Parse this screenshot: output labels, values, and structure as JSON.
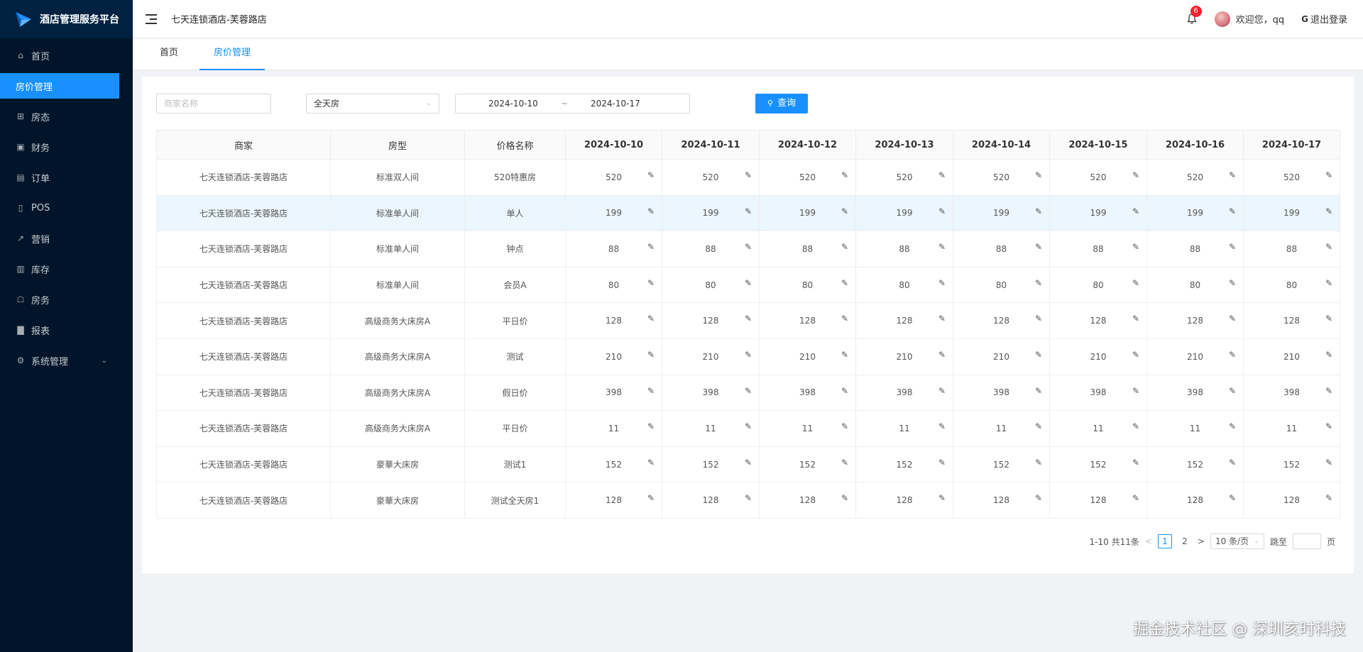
{
  "app": {
    "title": "酒店管理服务平台"
  },
  "sidebar": {
    "items": [
      {
        "icon": "home-icon",
        "label": "首页"
      },
      {
        "icon": "",
        "label": "房价管理"
      },
      {
        "icon": "grid-icon",
        "label": "房态"
      },
      {
        "icon": "wallet-icon",
        "label": "财务"
      },
      {
        "icon": "order-icon",
        "label": "订单"
      },
      {
        "icon": "pos-icon",
        "label": "POS"
      },
      {
        "icon": "chart-line-icon",
        "label": "营销"
      },
      {
        "icon": "inventory-icon",
        "label": "库存"
      },
      {
        "icon": "bank-icon",
        "label": "房务"
      },
      {
        "icon": "bar-chart-icon",
        "label": "报表"
      },
      {
        "icon": "gear-icon",
        "label": "系统管理"
      }
    ],
    "active_index": 1
  },
  "header": {
    "hotel_name": "七天连锁酒店-芙蓉路店",
    "notification_count": "6",
    "welcome": "欢迎您，qq",
    "logout": "退出登录"
  },
  "tabs": [
    {
      "label": "首页"
    },
    {
      "label": "房价管理"
    }
  ],
  "filters": {
    "shop_placeholder": "商家名称",
    "room_type": "全天房",
    "date_start": "2024-10-10",
    "date_separator": "~",
    "date_end": "2024-10-17",
    "query_button": "查询"
  },
  "table": {
    "columns": [
      "商家",
      "房型",
      "价格名称",
      "2024-10-10",
      "2024-10-11",
      "2024-10-12",
      "2024-10-13",
      "2024-10-14",
      "2024-10-15",
      "2024-10-16",
      "2024-10-17"
    ],
    "rows": [
      {
        "shop": "七天连锁酒店-芙蓉路店",
        "room": "标准双人间",
        "price_name": "520特惠房",
        "price": "520"
      },
      {
        "shop": "七天连锁酒店-芙蓉路店",
        "room": "标准单人间",
        "price_name": "单人",
        "price": "199"
      },
      {
        "shop": "七天连锁酒店-芙蓉路店",
        "room": "标准单人间",
        "price_name": "钟点",
        "price": "88"
      },
      {
        "shop": "七天连锁酒店-芙蓉路店",
        "room": "标准单人间",
        "price_name": "会员A",
        "price": "80"
      },
      {
        "shop": "七天连锁酒店-芙蓉路店",
        "room": "高级商务大床房A",
        "price_name": "平日价",
        "price": "128"
      },
      {
        "shop": "七天连锁酒店-芙蓉路店",
        "room": "高级商务大床房A",
        "price_name": "测试",
        "price": "210"
      },
      {
        "shop": "七天连锁酒店-芙蓉路店",
        "room": "高级商务大床房A",
        "price_name": "假日价",
        "price": "398"
      },
      {
        "shop": "七天连锁酒店-芙蓉路店",
        "room": "高级商务大床房A",
        "price_name": "平日价",
        "price": "11"
      },
      {
        "shop": "七天连锁酒店-芙蓉路店",
        "room": "豪華大床房",
        "price_name": "测试1",
        "price": "152"
      },
      {
        "shop": "七天连锁酒店-芙蓉路店",
        "room": "豪華大床房",
        "price_name": "测试全天房1",
        "price": "128"
      }
    ],
    "highlight_row": 1
  },
  "pagination": {
    "summary": "1-10 共11条",
    "pages": [
      "1",
      "2"
    ],
    "current": "1",
    "page_size": "10 条/页",
    "jump_label": "跳至",
    "page_suffix": "页"
  },
  "watermark": "掘金技术社区 @ 深圳亥时科技",
  "colors": {
    "sidebar_bg": "#001529",
    "accent": "#1890ff",
    "badge": "#f5222d"
  }
}
